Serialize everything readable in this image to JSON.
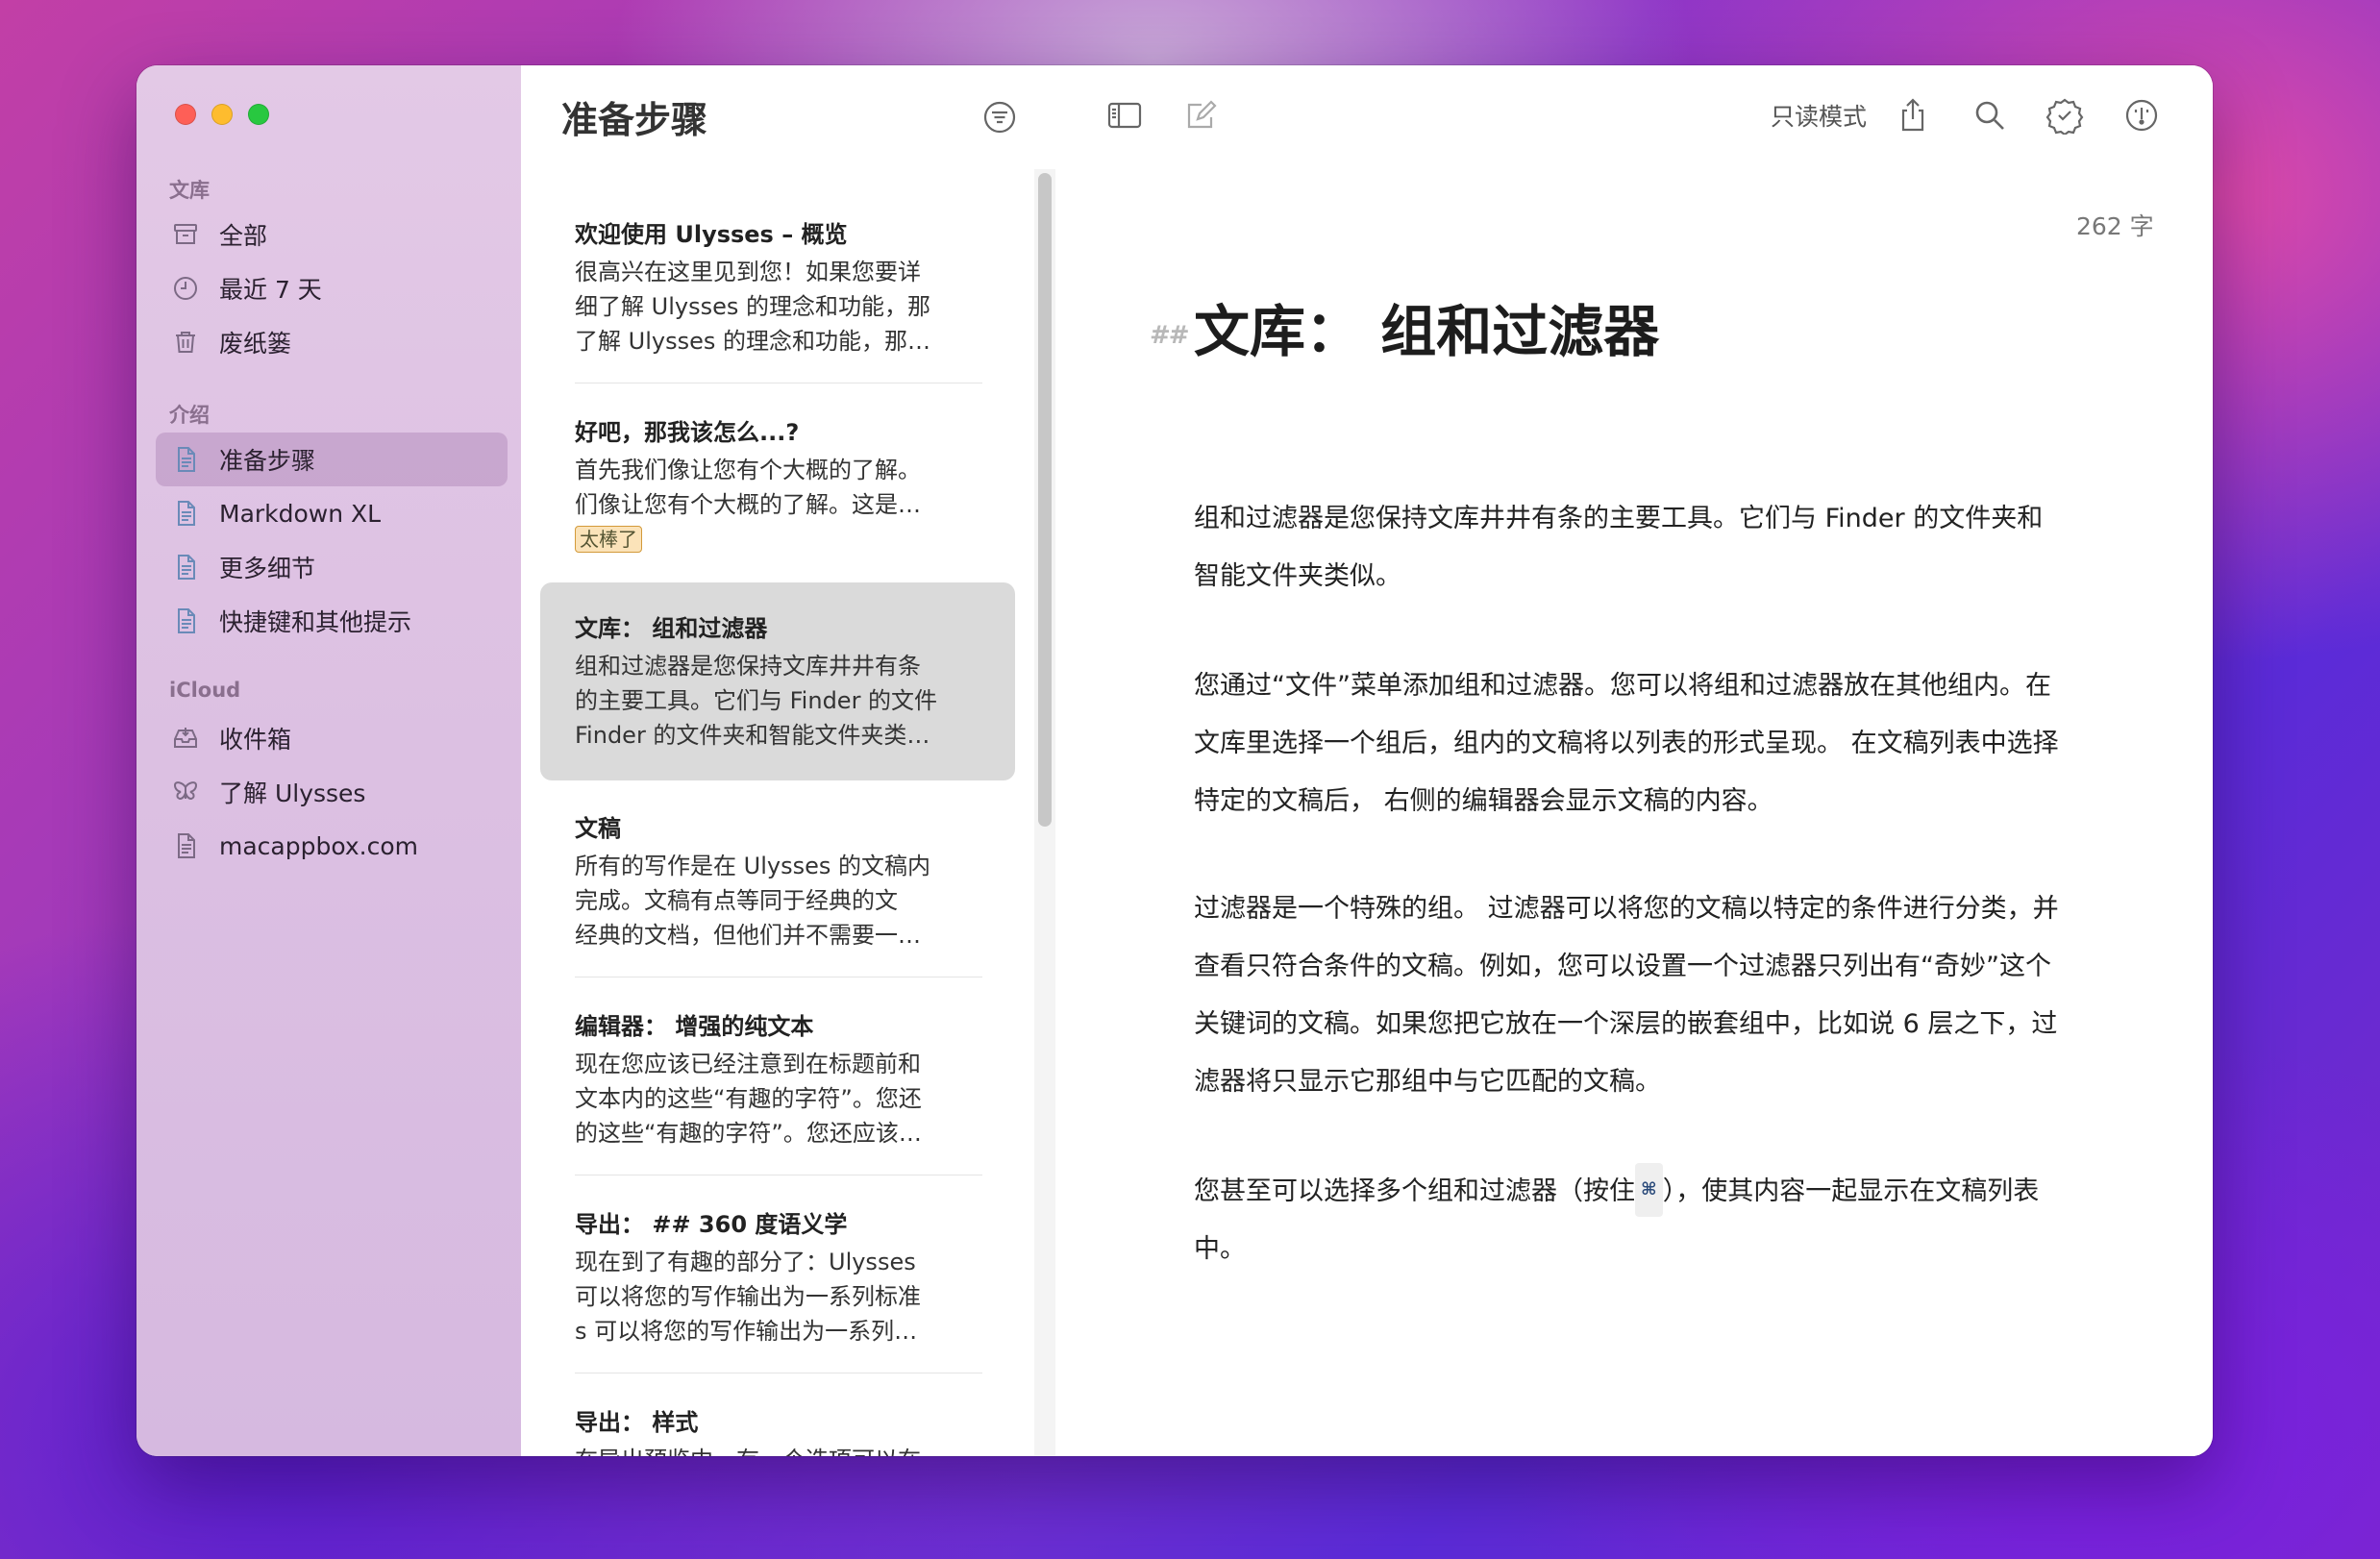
{
  "sidebar": {
    "sections": {
      "library": "文库",
      "intro": "介绍",
      "icloud": "iCloud"
    },
    "library_items": [
      {
        "label": "全部",
        "icon": "archive-box-icon"
      },
      {
        "label": "最近 7 天",
        "icon": "clock-icon"
      },
      {
        "label": "废纸篓",
        "icon": "trash-icon"
      }
    ],
    "intro_items": [
      {
        "label": "准备步骤",
        "icon": "document-icon",
        "active": true
      },
      {
        "label": "Markdown XL",
        "icon": "document-icon"
      },
      {
        "label": "更多细节",
        "icon": "document-icon"
      },
      {
        "label": "快捷键和其他提示",
        "icon": "document-icon"
      }
    ],
    "icloud_items": [
      {
        "label": "收件箱",
        "icon": "inbox-icon"
      },
      {
        "label": "了解 Ulysses",
        "icon": "butterfly-icon"
      },
      {
        "label": "macappbox.com",
        "icon": "document-icon"
      }
    ]
  },
  "list": {
    "title": "准备步骤",
    "sheets": [
      {
        "title": "欢迎使用 Ulysses – 概览",
        "lines": [
          "很高兴在这里见到您！如果您要详",
          "细了解 Ulysses 的理念和功能，那",
          "了解 Ulysses 的理念和功能，那…"
        ]
      },
      {
        "title": "好吧，那我该怎么...?",
        "lines": [
          "首先我们像让您有个大概的了解。",
          "们像让您有个大概的了解。这是…"
        ],
        "tag": "太棒了"
      },
      {
        "title": "文库： 组和过滤器",
        "lines": [
          "组和过滤器是您保持文库井井有条",
          "的主要工具。它们与 Finder 的文件",
          " Finder 的文件夹和智能文件夹类…"
        ],
        "selected": true
      },
      {
        "title": "文稿",
        "lines": [
          "所有的写作是在 Ulysses 的文稿内",
          "完成。文稿有点等同于经典的文",
          "经典的文档，但他们并不需要一…"
        ]
      },
      {
        "title": "编辑器： 增强的纯文本",
        "lines": [
          "现在您应该已经注意到在标题前和",
          "文本内的这些“有趣的字符”。您还",
          "的这些“有趣的字符”。您还应该…"
        ]
      },
      {
        "title": "导出： ## 360 度语义学",
        "lines": [
          "现在到了有趣的部分了：Ulysses",
          "可以将您的写作输出为一系列标准",
          "s 可以将您的写作输出为一系列…"
        ]
      },
      {
        "title": "导出： 样式",
        "lines": [
          "在导出预览中，有一个选项可以在"
        ]
      }
    ]
  },
  "editor": {
    "toolbar": {
      "readonly_label": "只读模式"
    },
    "word_count": "262 字",
    "heading_marker": "##",
    "heading": "文库： 组和过滤器",
    "paragraphs": [
      "组和过滤器是您保持文库井井有条的主要工具。它们与 Finder 的文件夹和智能文件夹类似。",
      "您通过“文件”菜单添加组和过滤器。您可以将组和过滤器放在其他组内。在文库里选择一个组后，组内的文稿将以列表的形式呈现。 在文稿列表中选择特定的文稿后， 右侧的编辑器会显示文稿的内容。",
      "过滤器是一个特殊的组。 过滤器可以将您的文稿以特定的条件进行分类，并查看只符合条件的文稿。例如，您可以设置一个过滤器只列出有“奇妙”这个关键词的文稿。如果您把它放在一个深层的嵌套组中，比如说 6 层之下，过滤器将只显示它那组中与它匹配的文稿。"
    ],
    "last_paragraph": {
      "before": "您甚至可以选择多个组和过滤器（按住",
      "kbd": "⌘",
      "after": "），使其内容一起显示在文稿列表中。"
    }
  }
}
